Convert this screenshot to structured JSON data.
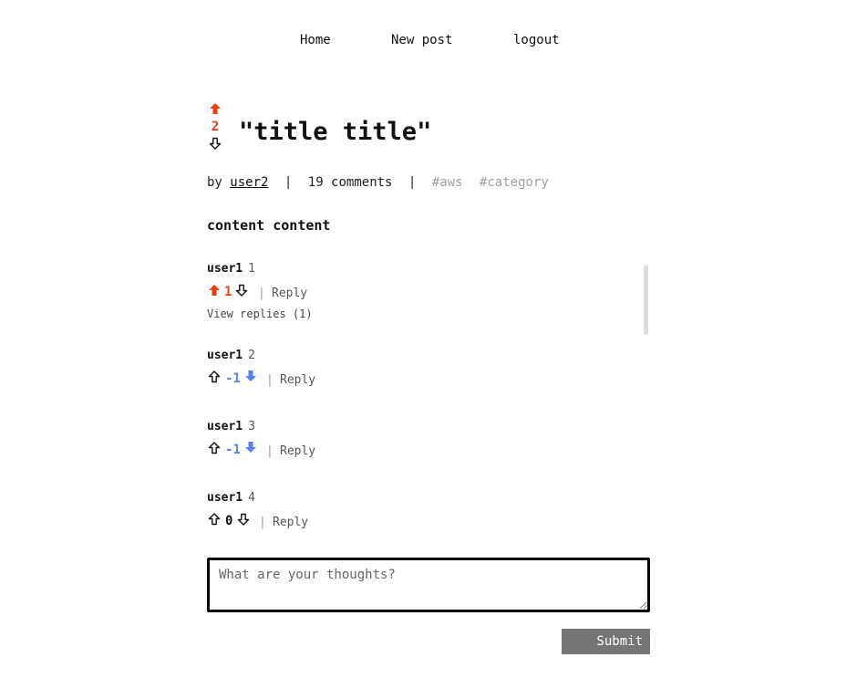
{
  "nav": {
    "home": "Home",
    "new_post": "New post",
    "logout": "logout"
  },
  "post": {
    "title": "\"title title\"",
    "score": "2",
    "vote_state": "up",
    "by_label": "by",
    "author": "user2",
    "separator": "|",
    "comments_count": "19 comments",
    "tags": [
      "#aws",
      "#category"
    ],
    "content": "content content"
  },
  "comments": [
    {
      "user": "user1",
      "num": "1",
      "score": "1",
      "vote_state": "up",
      "reply_label": "Reply",
      "view_replies": "View replies (1)"
    },
    {
      "user": "user1",
      "num": "2",
      "score": "-1",
      "vote_state": "down",
      "reply_label": "Reply"
    },
    {
      "user": "user1",
      "num": "3",
      "score": "-1",
      "vote_state": "down",
      "reply_label": "Reply"
    },
    {
      "user": "user1",
      "num": "4",
      "score": "0",
      "vote_state": "none",
      "reply_label": "Reply"
    }
  ],
  "comment_form": {
    "placeholder": "What are your thoughts?",
    "submit_label": "Submit"
  },
  "colors": {
    "upvote": "#e8400c",
    "downvote": "#5b7ff0",
    "tag": "#9aa0a6",
    "submit_bg": "#757575"
  },
  "icons": {
    "upvote_filled": "arrow-up-filled-icon",
    "upvote_outline": "arrow-up-outline-icon",
    "downvote_filled": "arrow-down-filled-icon",
    "downvote_outline": "arrow-down-outline-icon"
  }
}
